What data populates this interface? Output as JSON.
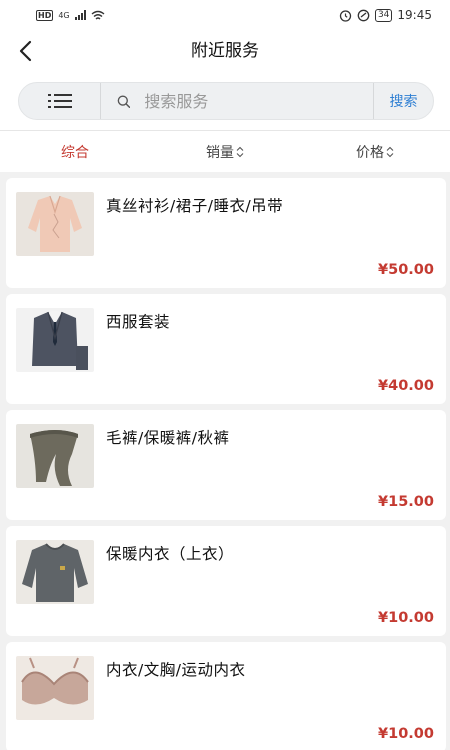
{
  "status_bar": {
    "hd": "HD",
    "network": "4G",
    "battery": "34",
    "time": "19:45"
  },
  "header": {
    "title": "附近服务"
  },
  "search": {
    "placeholder": "搜索服务",
    "button_label": "搜索"
  },
  "sort_tabs": [
    {
      "label": "综合",
      "active": true
    },
    {
      "label": "销量",
      "active": false
    },
    {
      "label": "价格",
      "active": false
    }
  ],
  "products": [
    {
      "name": "真丝衬衫/裙子/睡衣/吊带",
      "price": "¥50.00",
      "image": "blouse-image"
    },
    {
      "name": "西服套装",
      "price": "¥40.00",
      "image": "suit-image"
    },
    {
      "name": "毛裤/保暖裤/秋裤",
      "price": "¥15.00",
      "image": "leggings-image"
    },
    {
      "name": "保暖内衣（上衣）",
      "price": "¥10.00",
      "image": "thermal-top-image"
    },
    {
      "name": "内衣/文胸/运动内衣",
      "price": "¥10.00",
      "image": "bra-image"
    }
  ],
  "colors": {
    "accent_red": "#c43a31",
    "search_blue": "#2f7fd3"
  }
}
